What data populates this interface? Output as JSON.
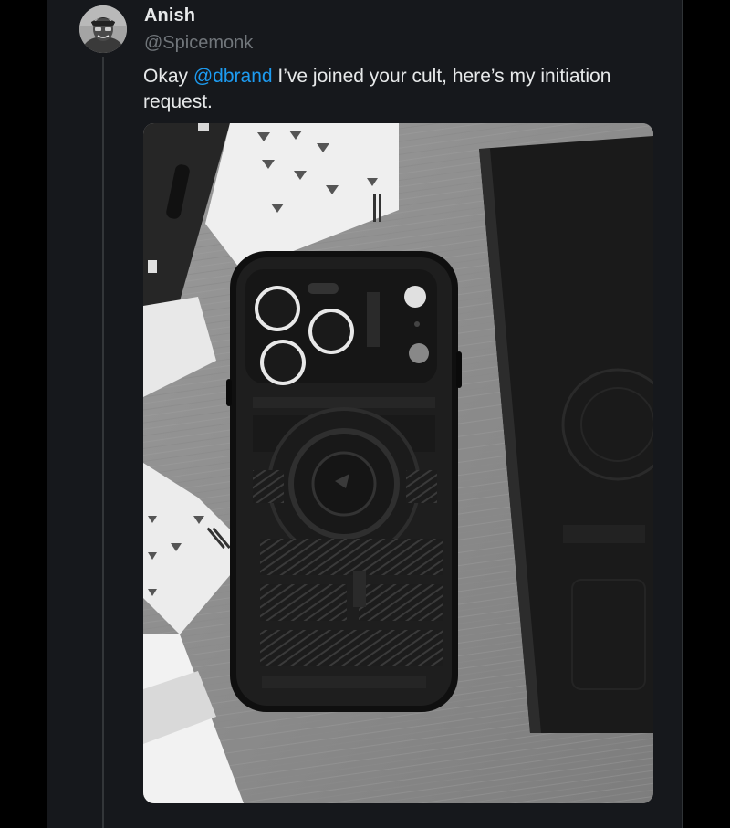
{
  "tweet": {
    "author": {
      "name": "Anish",
      "handle": "@Spicemonk",
      "avatar_icon": "avatar-photo"
    },
    "text": {
      "before": "Okay ",
      "mention": "@dbrand",
      "after": " I’ve joined your cult, here’s my initiation request."
    },
    "media": {
      "kind": "photo",
      "subject": "black phone case on wooden table with playing cards and a box"
    }
  },
  "colors": {
    "background": "#000000",
    "card": "#16181c",
    "text_primary": "#e7e9ea",
    "text_secondary": "#71767b",
    "link": "#1d9bf0"
  }
}
